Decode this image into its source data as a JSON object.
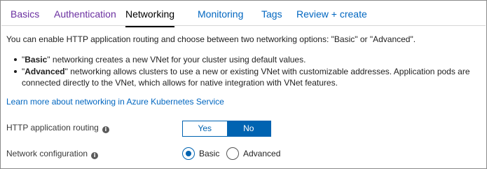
{
  "tabs": [
    {
      "label": "Basics",
      "state": "visited"
    },
    {
      "label": "Authentication",
      "state": "visited"
    },
    {
      "label": "Networking",
      "state": "active"
    },
    {
      "label": "Monitoring",
      "state": "normal"
    },
    {
      "label": "Tags",
      "state": "normal"
    },
    {
      "label": "Review + create",
      "state": "normal"
    }
  ],
  "intro": "You can enable HTTP application routing and choose between two networking options: \"Basic\" or \"Advanced\".",
  "bullets": [
    {
      "quote_open": "\"",
      "bold": "Basic",
      "quote_close": "\"",
      "rest": " networking creates a new VNet for your cluster using default values."
    },
    {
      "quote_open": "\"",
      "bold": "Advanced",
      "quote_close": "\"",
      "rest": " networking allows clusters to use a new or existing VNet with customizable addresses. Application pods are connected directly to the VNet, which allows for native integration with VNet features."
    }
  ],
  "learn_more": "Learn more about networking in Azure Kubernetes Service",
  "http_routing": {
    "label": "HTTP application routing",
    "info_icon": "i",
    "yes": "Yes",
    "no": "No",
    "selected": "No"
  },
  "network_config": {
    "label": "Network configuration",
    "info_icon": "i",
    "options": [
      "Basic",
      "Advanced"
    ],
    "selected": "Basic"
  },
  "colors": {
    "link": "#0066c0",
    "visited": "#6a2fa0",
    "accent": "#0063b1"
  }
}
